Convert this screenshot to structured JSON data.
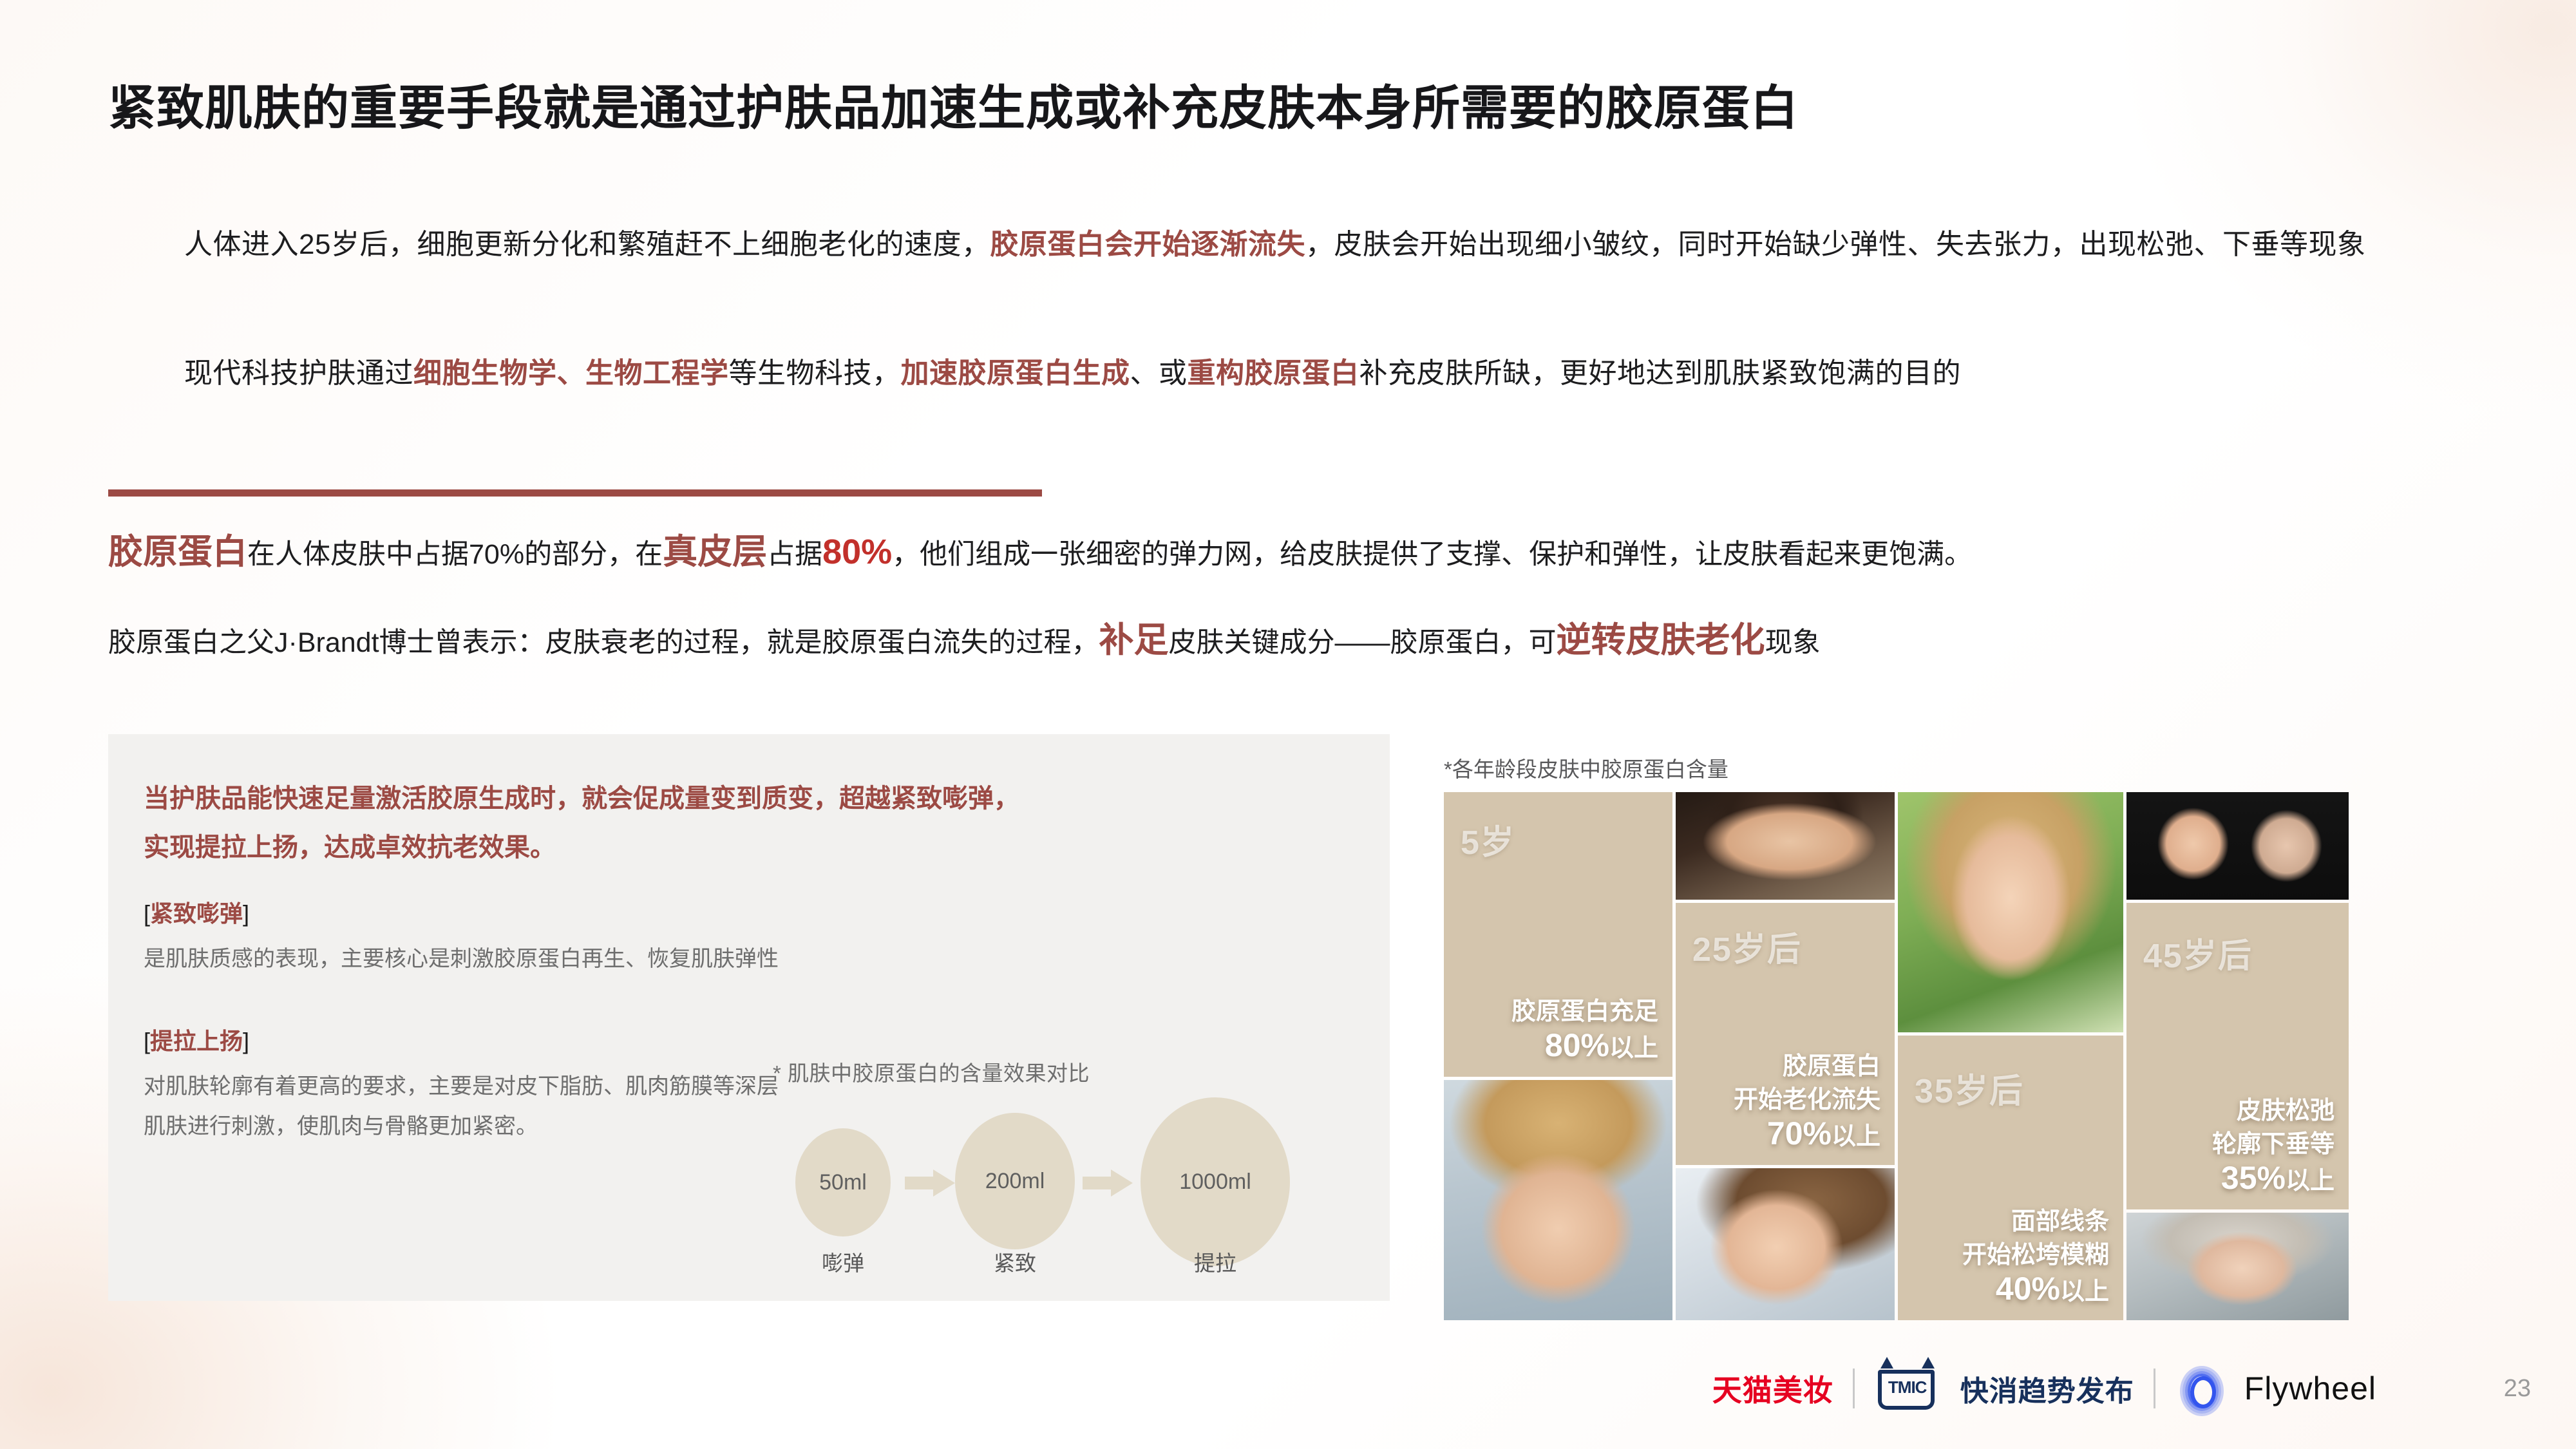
{
  "title": "紧致肌肤的重要手段就是通过护肤品加速生成或补充皮肤本身所需要的胶原蛋白",
  "intro": {
    "p1_a": "人体进入25岁后，细胞更新分化和繁殖赶不上细胞老化的速度，",
    "p1_hl": "胶原蛋白会开始逐渐流失",
    "p1_b": "，皮肤会开始出现细小皱纹，同时开始缺少弹性、失去张力，出现松弛、下垂等现象",
    "p2_a": "现代科技护肤通过",
    "p2_hl1": "细胞生物学、生物工程学",
    "p2_b": "等生物科技，",
    "p2_hl2": "加速胶原蛋白生成",
    "p2_c": "、或",
    "p2_hl3": "重构胶原蛋白",
    "p2_d": "补充皮肤所缺，更好地达到肌肤紧致饱满的目的"
  },
  "facts": {
    "l1_hl": "胶原蛋白",
    "l1_a": "在人体皮肤中占据70%的部分，在",
    "l1_hl2": "真皮层",
    "l1_a2": "占据",
    "l1_pct": "80%",
    "l1_b": "，他们组成一张细密的弹力网，给皮肤提供了支撑、保护和弹性，让皮肤看起来更饱满。",
    "l2_a": "胶原蛋白之父J·Brandt博士曾表示：皮肤衰老的过程，就是胶原蛋白流失的过程，",
    "l2_hl1": "补足",
    "l2_b": "皮肤关键成分——胶原蛋白，可",
    "l2_hl2": "逆转皮肤老化",
    "l2_c": "现象"
  },
  "left_card": {
    "headline_line1": "当护肤品能快速足量激活胶原生成时，就会促成量变到质变，超越紧致嘭弹，",
    "headline_line2": "实现提拉上扬，达成卓效抗老效果。",
    "blocks": [
      {
        "label_open": "[",
        "label": "紧致嘭弹",
        "label_close": "]",
        "text": "是肌肤质感的表现，主要核心是刺激胶原蛋白再生、恢复肌肤弹性"
      },
      {
        "label_open": "[",
        "label": "提拉上扬",
        "label_close": "]",
        "text": "对肌肤轮廓有着更高的要求，主要是对皮下脂肪、肌肉筋膜等深层肌肤进行刺激，使肌肉与骨骼更加紧密。"
      }
    ]
  },
  "chart_data": {
    "type": "bar",
    "title": "* 肌肤中胶原蛋白的含量效果对比",
    "categories": [
      "嘭弹",
      "紧致",
      "提拉"
    ],
    "values": [
      50,
      200,
      1000
    ],
    "value_labels": [
      "50ml",
      "200ml",
      "1000ml"
    ],
    "unit": "ml",
    "xlabel": "",
    "ylabel": "",
    "legend": "none",
    "notes": "三个递增的米色圆形，用箭头连接，表示含量由 50ml 到 200ml 再到 1000ml 递增"
  },
  "photo_grid": {
    "note": "*各年龄段皮肤中胶原蛋白含量",
    "stages": [
      {
        "age": "5岁",
        "caption_line1": "胶原蛋白充足",
        "pct": "80%",
        "caption_line2": "以上",
        "photo": "child-photo"
      },
      {
        "age": "25岁后",
        "caption_line1": "胶原蛋白",
        "caption_line2": "开始老化流失",
        "pct": "70%",
        "caption_line3": "以上",
        "photo": "young-woman-photo"
      },
      {
        "age": "35岁后",
        "caption_line1": "面部线条",
        "caption_line2": "开始松垮模糊",
        "pct": "40%",
        "caption_line3": "以上",
        "photo": "middle-aged-woman-photo"
      },
      {
        "age": "45岁后",
        "caption_line1": "皮肤松弛",
        "caption_line2": "轮廓下垂等",
        "pct": "35%",
        "caption_line3": "以上",
        "photo": "senior-woman-photo"
      }
    ]
  },
  "footer": {
    "tmall_beauty": "天猫美妆",
    "tmic_mark": "TMIC",
    "tmic_label": "快消趋势发布",
    "flywheel": "Flywheel",
    "page_number": "23"
  },
  "colors": {
    "accent": "#9c4a44",
    "accent_bright": "#c2302b",
    "beige": "#d4c5ad",
    "bubble": "#e2dac8",
    "card_bg": "#f2f1ef",
    "tmall_red": "#e60021",
    "tmic_navy": "#17305c",
    "flywheel_blue": "#3355ee"
  }
}
